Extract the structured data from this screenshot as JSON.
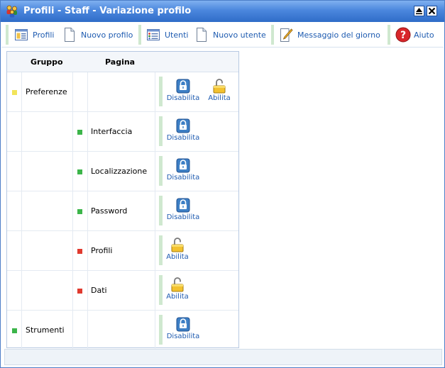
{
  "window": {
    "title": "Profili - Staff - Variazione profilo",
    "icon": "users-group-icon",
    "controls": [
      "maximize-icon",
      "close-icon"
    ]
  },
  "toolbar": {
    "items": [
      {
        "label": "Profili",
        "icon": "profiles-list-icon"
      },
      {
        "label": "Nuovo profilo",
        "icon": "new-document-icon"
      },
      {
        "label": "Utenti",
        "icon": "users-list-icon"
      },
      {
        "label": "Nuovo utente",
        "icon": "new-document-icon"
      },
      {
        "label": "Messaggio del giorno",
        "icon": "pencil-note-icon"
      },
      {
        "label": "Aiuto",
        "icon": "help-icon"
      }
    ]
  },
  "table": {
    "columns": [
      "Gruppo",
      "Pagina"
    ],
    "rows": [
      {
        "group": "Preferenze",
        "page": "",
        "status": "partial",
        "actions": [
          "Disabilita",
          "Abilita"
        ]
      },
      {
        "group": "",
        "page": "Interfaccia",
        "status": "enabled",
        "actions": [
          "Disabilita"
        ]
      },
      {
        "group": "",
        "page": "Localizzazione",
        "status": "enabled",
        "actions": [
          "Disabilita"
        ]
      },
      {
        "group": "",
        "page": "Password",
        "status": "enabled",
        "actions": [
          "Disabilita"
        ]
      },
      {
        "group": "",
        "page": "Profili",
        "status": "disabled",
        "actions": [
          "Abilita"
        ]
      },
      {
        "group": "",
        "page": "Dati",
        "status": "disabled",
        "actions": [
          "Abilita"
        ]
      },
      {
        "group": "Strumenti",
        "page": "",
        "status": "enabled",
        "actions": [
          "Disabilita"
        ]
      }
    ]
  },
  "colors": {
    "titlebar": "#3f7bd6",
    "link": "#1e5bb0",
    "status_enabled": "#3cb54a",
    "status_disabled": "#e03a2f",
    "status_partial": "#f2e45a"
  }
}
